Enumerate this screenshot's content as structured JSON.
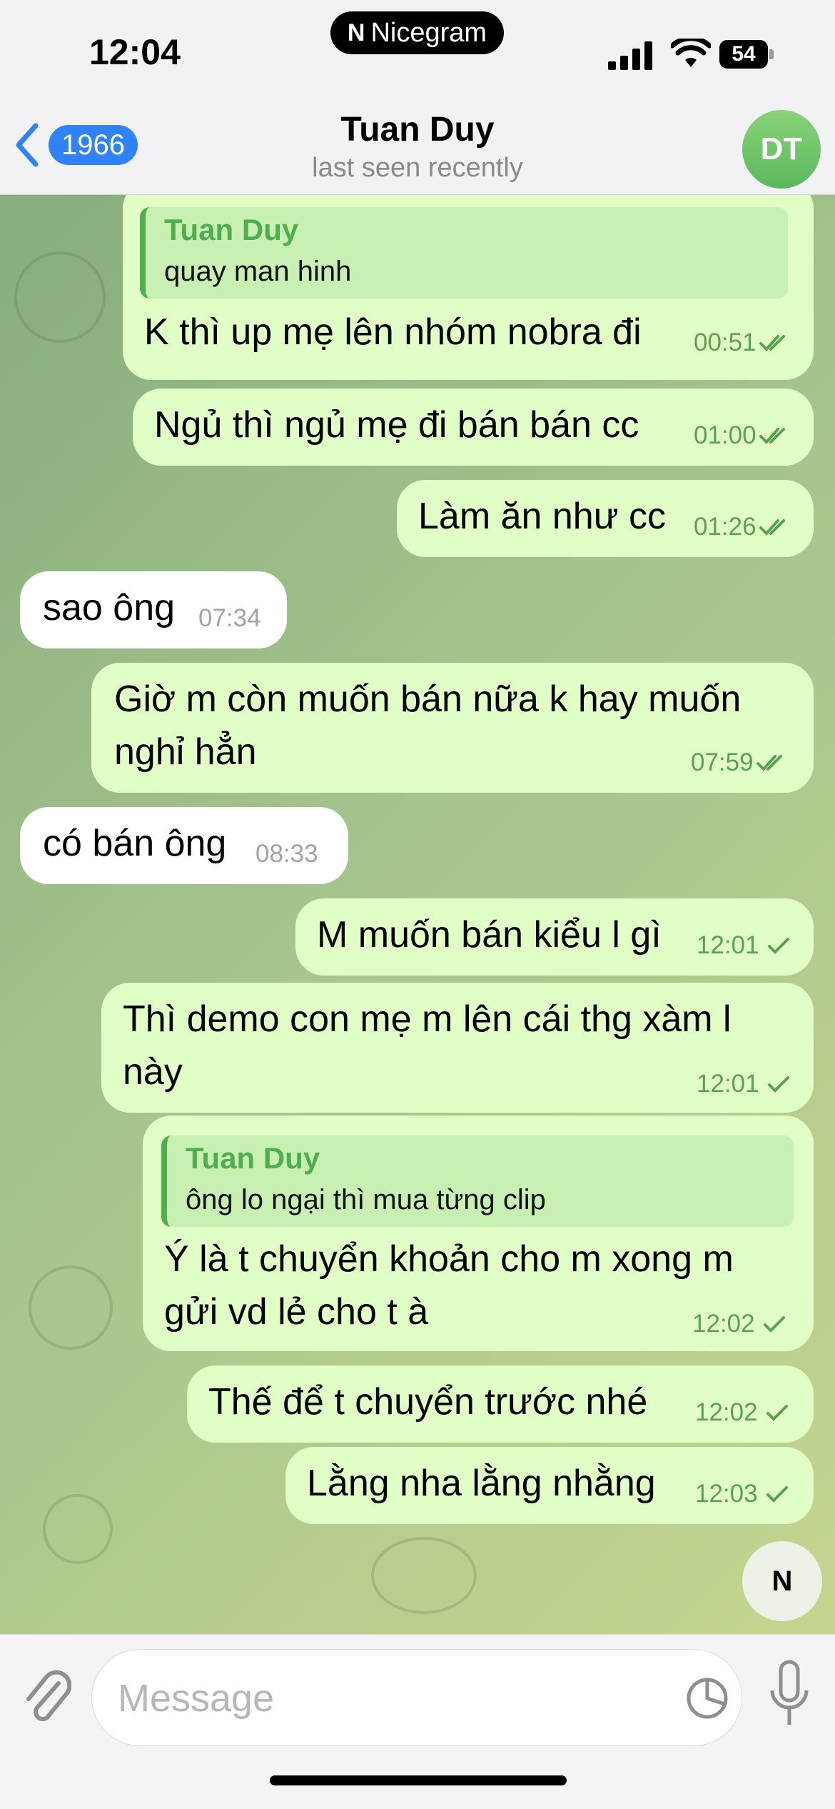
{
  "status": {
    "time": "12:04",
    "battery": "54",
    "carrier_pill": "Nicegram",
    "carrier_logo": "N"
  },
  "header": {
    "back_count": "1966",
    "title": "Tuan Duy",
    "subtitle": "last seen recently",
    "avatar_initials": "DT"
  },
  "messages": [
    {
      "dir": "out",
      "reply_name": "Tuan Duy",
      "reply_text": "quay man hinh",
      "text": "K thì up mẹ lên nhóm nobra đi",
      "time": "00:51",
      "status": "read"
    },
    {
      "dir": "out",
      "text": "Ngủ thì ngủ mẹ đi bán bán cc",
      "time": "01:00",
      "status": "read"
    },
    {
      "dir": "out",
      "text": "Làm ăn như cc",
      "time": "01:26",
      "status": "read"
    },
    {
      "dir": "in",
      "text": "sao ông",
      "time": "07:34"
    },
    {
      "dir": "out",
      "text_line1": "Giờ m còn muốn bán nữa k hay muốn",
      "text_line2": "nghỉ hẳn",
      "time": "07:59",
      "status": "read"
    },
    {
      "dir": "in",
      "text": "có bán ông",
      "time": "08:33"
    },
    {
      "dir": "out",
      "text": "M muốn bán kiểu l gì",
      "time": "12:01",
      "status": "sent"
    },
    {
      "dir": "out",
      "text_line1": "Thì demo con mẹ m lên cái thg xàm l",
      "text_line2": "này",
      "time": "12:01",
      "status": "sent"
    },
    {
      "dir": "out",
      "reply_name": "Tuan Duy",
      "reply_text": "ông lo ngại thì mua từng clip",
      "text_line1": "Ý là t chuyển khoản cho m xong m",
      "text_line2": "gửi vd lẻ cho t à",
      "time": "12:02",
      "status": "sent"
    },
    {
      "dir": "out",
      "text": "Thế để t chuyển trước nhé",
      "time": "12:02",
      "status": "sent"
    },
    {
      "dir": "out",
      "text": "Lằng nha lằng nhằng",
      "time": "12:03",
      "status": "sent"
    }
  ],
  "jump_button": "N",
  "composer": {
    "placeholder": "Message"
  }
}
